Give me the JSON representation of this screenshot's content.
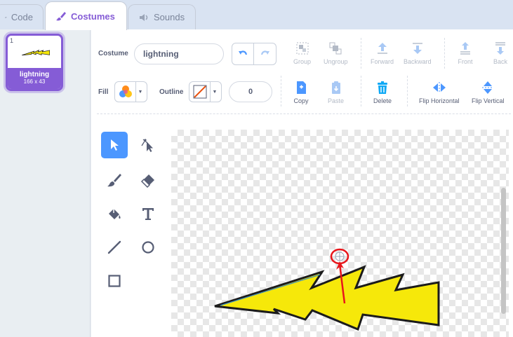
{
  "tabs": [
    {
      "label": "Code",
      "icon": "code-icon"
    },
    {
      "label": "Costumes",
      "icon": "brush-icon"
    },
    {
      "label": "Sounds",
      "icon": "speaker-icon"
    }
  ],
  "costume_list": [
    {
      "number": "1",
      "name": "lightning",
      "size": "166 x 43"
    }
  ],
  "toolbar": {
    "costume_label": "Costume",
    "costume_name": "lightning",
    "fill_label": "Fill",
    "outline_label": "Outline",
    "outline_width": "0",
    "group_label": "Group",
    "ungroup_label": "Ungroup",
    "forward_label": "Forward",
    "backward_label": "Backward",
    "front_label": "Front",
    "back_label": "Back",
    "copy_label": "Copy",
    "paste_label": "Paste",
    "delete_label": "Delete",
    "flip_h_label": "Flip Horizontal",
    "flip_v_label": "Flip Vertical"
  },
  "colors": {
    "accent": "#855cd6",
    "select_blue": "#4c97ff",
    "lightning_fill": "#f6e80a",
    "lightning_stroke": "#1b1b1b",
    "annotation_red": "#e8151b",
    "delete_blue": "#0fa9f5"
  },
  "tools": [
    "select-tool",
    "reshape-tool",
    "brush-tool",
    "eraser-tool",
    "fill-tool",
    "text-tool",
    "line-tool",
    "circle-tool",
    "rectangle-tool"
  ],
  "selected_tool": "select-tool"
}
